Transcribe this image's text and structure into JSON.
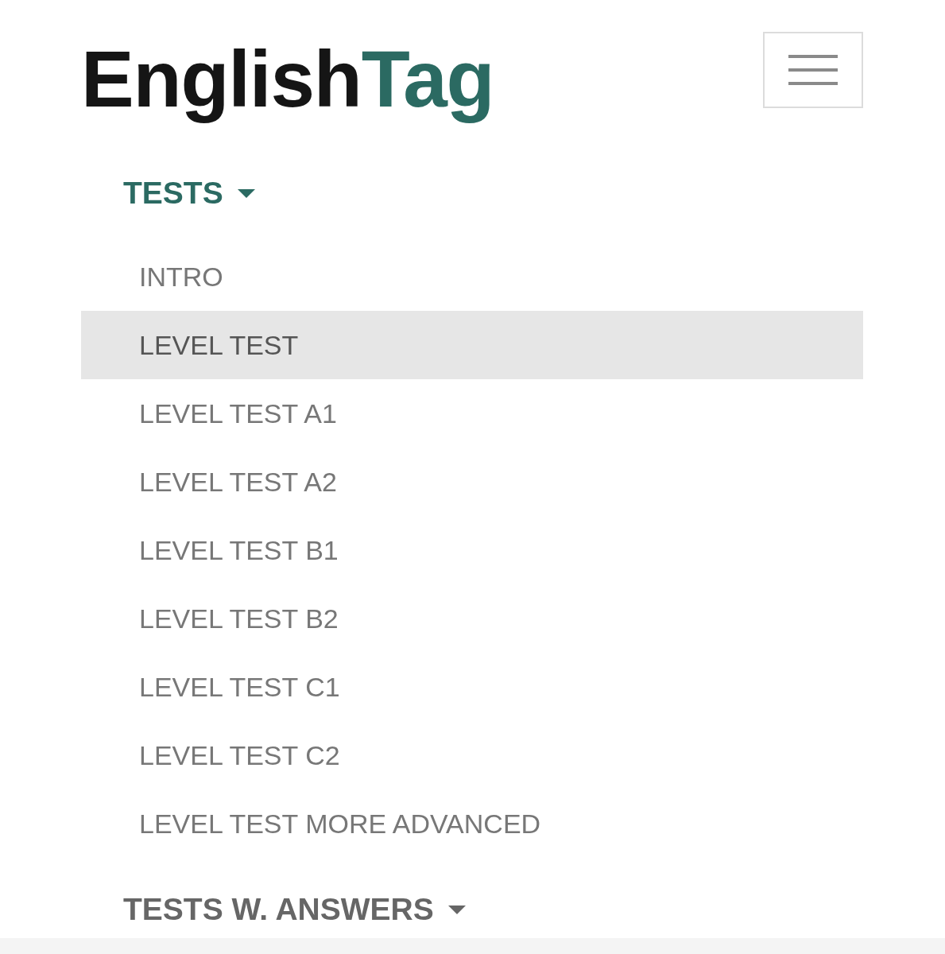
{
  "header": {
    "logo": [
      {
        "text": "English",
        "color": "#151515"
      },
      {
        "text": "Tag",
        "color": "#2b6a62"
      }
    ]
  },
  "menu": [
    {
      "label": "TESTS",
      "expanded": true,
      "children": [
        {
          "label": "INTRO",
          "selected": false
        },
        {
          "label": "LEVEL TEST",
          "selected": true
        },
        {
          "label": "LEVEL TEST A1",
          "selected": false
        },
        {
          "label": "LEVEL TEST A2",
          "selected": false
        },
        {
          "label": "LEVEL TEST B1",
          "selected": false
        },
        {
          "label": "LEVEL TEST B2",
          "selected": false
        },
        {
          "label": "LEVEL TEST C1",
          "selected": false
        },
        {
          "label": "LEVEL TEST C2",
          "selected": false
        },
        {
          "label": "LEVEL TEST MORE ADVANCED",
          "selected": false
        }
      ]
    },
    {
      "label": "TESTS W. ANSWERS",
      "expanded": false
    }
  ]
}
